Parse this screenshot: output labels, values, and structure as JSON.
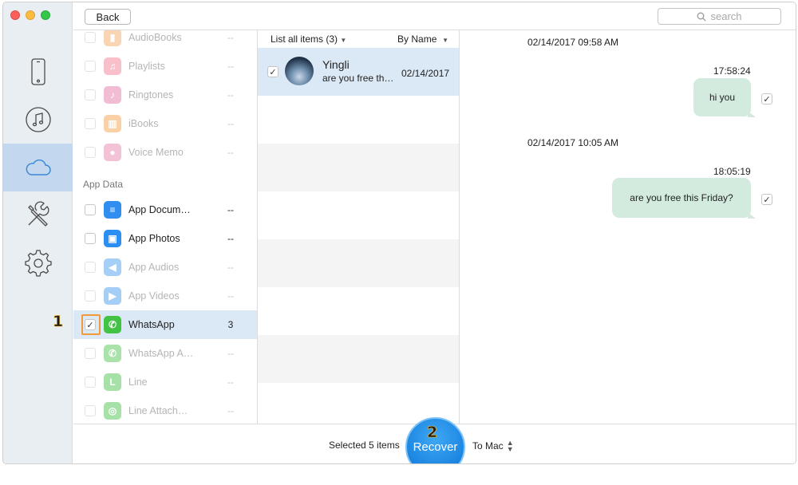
{
  "topbar": {
    "back_label": "Back",
    "search_placeholder": "search"
  },
  "nav": [
    {
      "name": "device",
      "icon": "iphone-icon",
      "active": false
    },
    {
      "name": "itunes",
      "icon": "music-note-icon",
      "active": false
    },
    {
      "name": "icloud",
      "icon": "cloud-icon",
      "active": true
    },
    {
      "name": "tools",
      "icon": "tools-icon",
      "active": false
    },
    {
      "name": "settings",
      "icon": "gear-icon",
      "active": false
    }
  ],
  "categories": {
    "items_top": [
      {
        "label": "AudioBooks",
        "count": "--",
        "color": "#f6a35a",
        "glyph": "▮"
      },
      {
        "label": "Playlists",
        "count": "--",
        "color": "#f2768e",
        "glyph": "♫"
      },
      {
        "label": "Ringtones",
        "count": "--",
        "color": "#e56ba3",
        "glyph": "♪"
      },
      {
        "label": "iBooks",
        "count": "--",
        "color": "#f59b3c",
        "glyph": "▥"
      },
      {
        "label": "Voice Memo",
        "count": "--",
        "color": "#e87aa7",
        "glyph": "●"
      }
    ],
    "section_title": "App Data",
    "items_app": [
      {
        "label": "App Docum…",
        "count": "--",
        "color": "#2f8ef0",
        "glyph": "≡"
      },
      {
        "label": "App Photos",
        "count": "--",
        "color": "#2b8ef3",
        "glyph": "▣"
      },
      {
        "label": "App Audios",
        "count": "--",
        "color": "#3b97f0",
        "glyph": "◀"
      },
      {
        "label": "App Videos",
        "count": "--",
        "color": "#3a95ef",
        "glyph": "▶"
      },
      {
        "label": "WhatsApp",
        "count": "3",
        "color": "#43c345",
        "glyph": "✆"
      },
      {
        "label": "WhatsApp A…",
        "count": "--",
        "color": "#43c345",
        "glyph": "✆"
      },
      {
        "label": "Line",
        "count": "--",
        "color": "#3cc13f",
        "glyph": "L"
      },
      {
        "label": "Line Attach…",
        "count": "--",
        "color": "#3cc13f",
        "glyph": "◎"
      }
    ]
  },
  "contacts": {
    "list_label": "List all items (3)",
    "sort_label": "By Name",
    "items": [
      {
        "name": "Yingli",
        "preview": "are you free th…",
        "date": "02/14/2017"
      }
    ]
  },
  "chat": {
    "groups": [
      {
        "date": "02/14/2017 09:58 AM",
        "time": "17:58:24",
        "text": "hi you"
      },
      {
        "date": "02/14/2017 10:05 AM",
        "time": "18:05:19",
        "text": "are you free this Friday?"
      }
    ]
  },
  "bottom": {
    "selected_text": "Selected 5 items",
    "recover_label": "Recover",
    "destination": "To Mac"
  },
  "steps": {
    "one": "1",
    "two": "2"
  }
}
